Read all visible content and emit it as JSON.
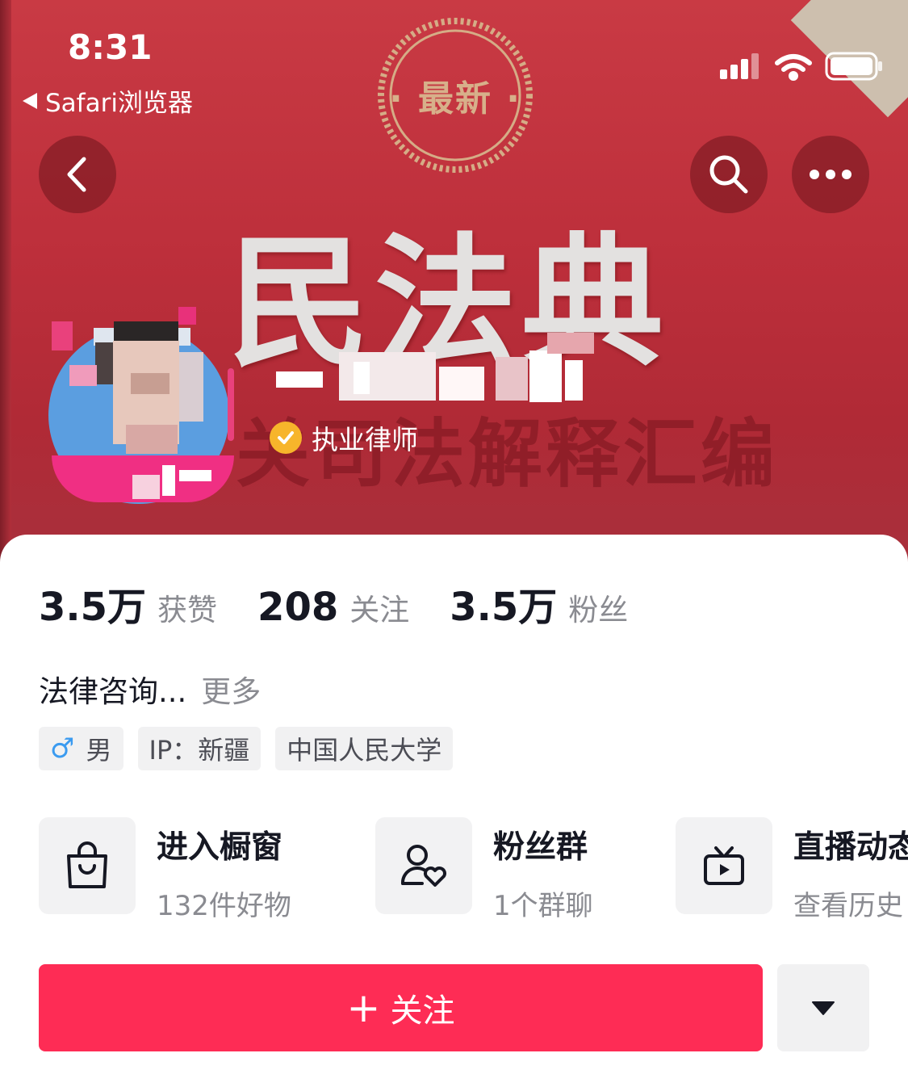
{
  "status_bar": {
    "time": "8:31",
    "back_app_label": "Safari浏览器"
  },
  "banner": {
    "seal_text": "· 最新 ·",
    "book_title": "民法典",
    "book_subtitle": "关司法解释汇编"
  },
  "nav": {
    "back_icon": "chevron-left-icon",
    "search_icon": "search-icon",
    "more_icon": "more-icon"
  },
  "profile": {
    "verification_label": "执业律师"
  },
  "stats": [
    {
      "value": "3.5万",
      "label": "获赞"
    },
    {
      "value": "208",
      "label": "关注"
    },
    {
      "value": "3.5万",
      "label": "粉丝"
    }
  ],
  "bio": {
    "text": "法律咨询...",
    "more_label": "更多"
  },
  "tags": {
    "gender_symbol": "♂",
    "gender": "男",
    "ip": "IP：新疆",
    "school": "中国人民大学"
  },
  "shortcuts": [
    {
      "title": "进入橱窗",
      "subtitle": "132件好物",
      "icon": "shopping-bag-icon"
    },
    {
      "title": "粉丝群",
      "subtitle": "1个群聊",
      "icon": "fan-group-icon"
    },
    {
      "title": "直播动态",
      "subtitle": "查看历史",
      "icon": "tv-play-icon"
    }
  ],
  "actions": {
    "follow_plus": "+",
    "follow_label": "关注"
  },
  "colors": {
    "banner_red": "#c0323e",
    "follow_red": "#fe2c55",
    "verify_gold": "#f7b52b",
    "gender_blue": "#3b9bf0"
  }
}
